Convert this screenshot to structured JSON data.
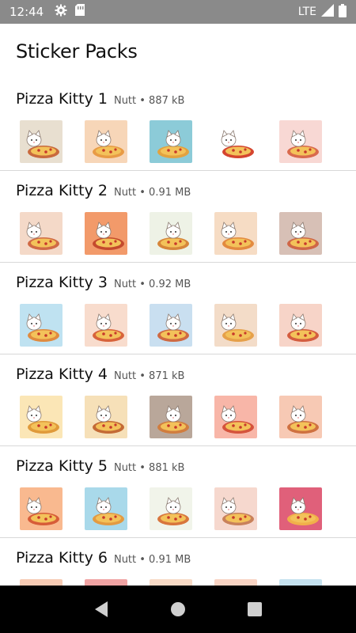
{
  "status_bar": {
    "time": "12:44",
    "network": "LTE",
    "icons": [
      "gear-icon",
      "sim-card-icon",
      "signal-icon",
      "battery-icon"
    ]
  },
  "header": {
    "title": "Sticker Packs"
  },
  "packs": [
    {
      "name": "Pizza Kitty 1",
      "meta": "Nutt • 887 kB",
      "stickers": [
        {
          "bg": "#e8dfd0",
          "accent": "#c96a3d"
        },
        {
          "bg": "#f7d6b8",
          "accent": "#e89b45"
        },
        {
          "bg": "#8ccbd8",
          "accent": "#e2a23f"
        },
        {
          "bg": "#ffffff",
          "accent": "#d5452f"
        },
        {
          "bg": "#f8d8d4",
          "accent": "#d96a4d"
        }
      ]
    },
    {
      "name": "Pizza Kitty 2",
      "meta": "Nutt • 0.91 MB",
      "stickers": [
        {
          "bg": "#f4d9c8",
          "accent": "#d06a45"
        },
        {
          "bg": "#f29a6a",
          "accent": "#c44a2d"
        },
        {
          "bg": "#eef2e6",
          "accent": "#d6863a"
        },
        {
          "bg": "#f6dcc4",
          "accent": "#e38a3f"
        },
        {
          "bg": "#d7c0b6",
          "accent": "#cf6747"
        }
      ]
    },
    {
      "name": "Pizza Kitty 3",
      "meta": "Nutt • 0.92 MB",
      "stickers": [
        {
          "bg": "#bfe2f1",
          "accent": "#e08b3f"
        },
        {
          "bg": "#f8dccd",
          "accent": "#d8633a"
        },
        {
          "bg": "#c9dff0",
          "accent": "#cf6a42"
        },
        {
          "bg": "#f3dcc8",
          "accent": "#e6a049"
        },
        {
          "bg": "#f7d4c8",
          "accent": "#d45d3f"
        }
      ]
    },
    {
      "name": "Pizza Kitty 4",
      "meta": "Nutt • 871 kB",
      "stickers": [
        {
          "bg": "#fbe6b6",
          "accent": "#e09a3a"
        },
        {
          "bg": "#f6e0b8",
          "accent": "#c46a35"
        },
        {
          "bg": "#b9a79a",
          "accent": "#d17d3e"
        },
        {
          "bg": "#f8b6a8",
          "accent": "#d5533c"
        },
        {
          "bg": "#f7c9b4",
          "accent": "#cf7140"
        }
      ]
    },
    {
      "name": "Pizza Kitty 5",
      "meta": "Nutt • 881 kB",
      "stickers": [
        {
          "bg": "#f9b98f",
          "accent": "#d75c38"
        },
        {
          "bg": "#a9d9ea",
          "accent": "#e39a41"
        },
        {
          "bg": "#f1f4ea",
          "accent": "#d8763d"
        },
        {
          "bg": "#f6d8ce",
          "accent": "#c9815a"
        },
        {
          "bg": "#e0607a",
          "accent": "#f1b04a"
        }
      ]
    },
    {
      "name": "Pizza Kitty 6",
      "meta": "Nutt • 0.91 MB",
      "stickers": [
        {
          "bg": "#f7cbb4",
          "accent": "#d86a43"
        },
        {
          "bg": "#f0a3a3",
          "accent": "#d4503c"
        },
        {
          "bg": "#f8dac6",
          "accent": "#cf6b47"
        },
        {
          "bg": "#f9d4c4",
          "accent": "#e08a45"
        },
        {
          "bg": "#c5e2ef",
          "accent": "#d77a40"
        }
      ]
    }
  ],
  "nav": {
    "icons": [
      "back-icon",
      "home-icon",
      "recents-icon"
    ]
  }
}
